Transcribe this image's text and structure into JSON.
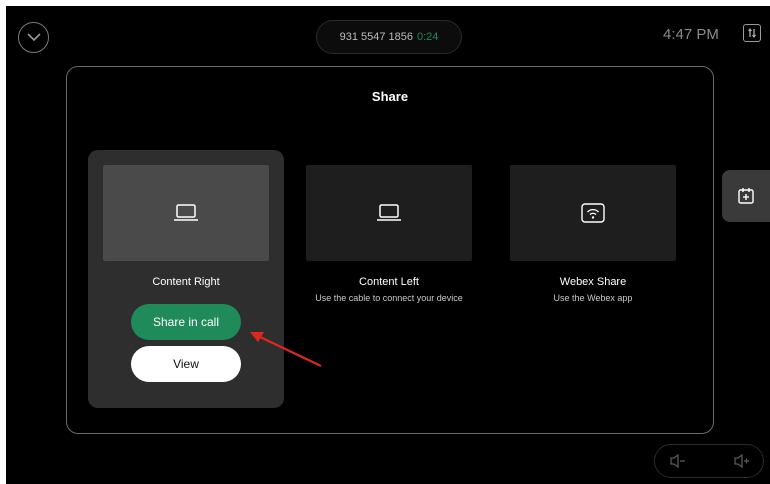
{
  "topbar": {
    "call_number": "931 5547 1856",
    "call_timer": "0:24",
    "clock": "4:47 PM",
    "icons": {
      "collapse": "chevron-down-icon",
      "layout": "layout-toggle-icon"
    }
  },
  "share_dialog": {
    "title": "Share",
    "sources": [
      {
        "title": "Content Right",
        "description": "",
        "icon": "laptop-icon",
        "selected": true
      },
      {
        "title": "Content Left",
        "description": "Use the cable to connect your device",
        "icon": "laptop-icon",
        "selected": false
      },
      {
        "title": "Webex Share",
        "description": "Use the Webex app",
        "icon": "wireless-share-icon",
        "selected": false
      }
    ],
    "share_in_call_label": "Share in call",
    "view_label": "View"
  },
  "side_panel": {
    "icon": "add-calendar-icon"
  },
  "volume": {
    "down_icon": "volume-down-icon",
    "up_icon": "volume-up-icon"
  },
  "colors": {
    "background": "#000000",
    "accent_green": "#1f8a5a",
    "selected_card": "#2e2e2e",
    "annotation_arrow": "#e0261f"
  }
}
